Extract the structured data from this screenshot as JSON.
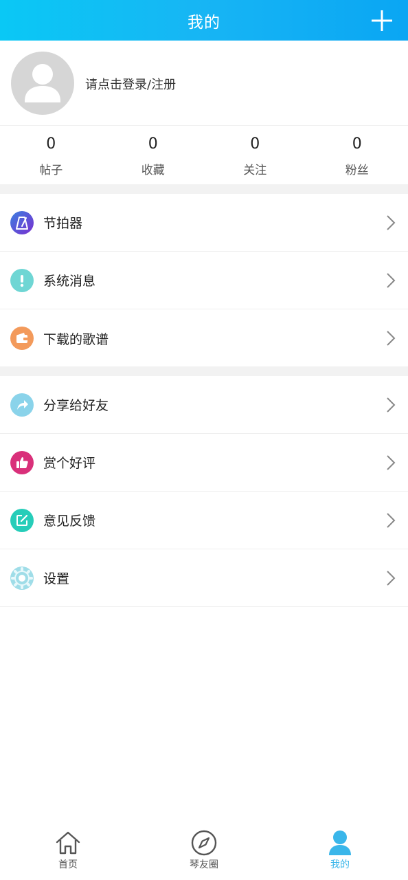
{
  "header": {
    "title": "我的",
    "add_icon": "plus-icon"
  },
  "profile": {
    "login_prompt": "请点击登录/注册",
    "avatar_icon": "user-avatar-icon"
  },
  "stats": [
    {
      "value": "0",
      "label": "帖子"
    },
    {
      "value": "0",
      "label": "收藏"
    },
    {
      "value": "0",
      "label": "关注"
    },
    {
      "value": "0",
      "label": "粉丝"
    }
  ],
  "menu_group1": [
    {
      "label": "节拍器",
      "icon": "metronome-icon",
      "color": "#5b3fd6"
    },
    {
      "label": "系统消息",
      "icon": "exclamation-icon",
      "color": "#6fd6d4"
    },
    {
      "label": "下载的歌谱",
      "icon": "wallet-icon",
      "color": "#f39a5b"
    }
  ],
  "menu_group2": [
    {
      "label": "分享给好友",
      "icon": "share-arrow-icon",
      "color": "#8ad3ea"
    },
    {
      "label": "赏个好评",
      "icon": "thumbs-up-icon",
      "color": "#d9307a"
    },
    {
      "label": "意见反馈",
      "icon": "edit-icon",
      "color": "#26cdb9"
    },
    {
      "label": "设置",
      "icon": "gear-icon",
      "color": "#9fdde8"
    }
  ],
  "tabbar": [
    {
      "label": "首页",
      "icon": "home-icon",
      "active": false
    },
    {
      "label": "琴友圈",
      "icon": "compass-icon",
      "active": false
    },
    {
      "label": "我的",
      "icon": "user-icon",
      "active": true
    }
  ],
  "colors": {
    "accent": "#17b5f4",
    "active_tab": "#3ab6ea"
  }
}
